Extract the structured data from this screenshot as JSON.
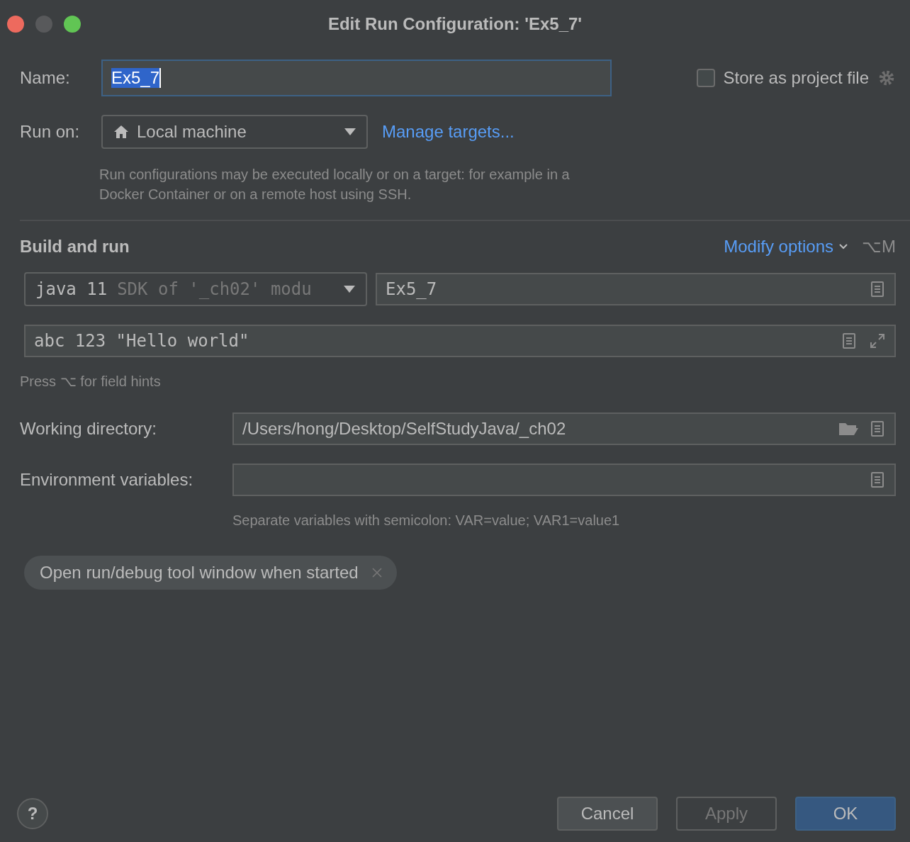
{
  "window": {
    "title": "Edit Run Configuration: 'Ex5_7'"
  },
  "name_field": {
    "label": "Name:",
    "value": "Ex5_7",
    "text_selected": true
  },
  "store_as_project_file": {
    "label": "Store as project file",
    "checked": false
  },
  "run_on": {
    "label": "Run on:",
    "value": "Local machine",
    "link": "Manage targets...",
    "hint": "Run configurations may be executed locally or on a target: for example in a Docker Container or on a remote host using SSH."
  },
  "build_and_run": {
    "title": "Build and run",
    "modify_options": "Modify options",
    "shortcut": "⌥M",
    "sdk": {
      "value": "java 11",
      "detail": "SDK of '_ch02' modu"
    },
    "main_class": "Ex5_7",
    "program_arguments": "abc 123 \"Hello world\"",
    "field_hints": "Press ⌥ for field hints"
  },
  "working_directory": {
    "label": "Working directory:",
    "value": "/Users/hong/Desktop/SelfStudyJava/_ch02"
  },
  "environment_variables": {
    "label": "Environment variables:",
    "hint": "Separate variables with semicolon: VAR=value; VAR1=value1"
  },
  "chips": [
    {
      "label": "Open run/debug tool window when started"
    }
  ],
  "help": "?",
  "buttons": [
    {
      "label": "Cancel",
      "kind": "default",
      "disabled": false
    },
    {
      "label": "Apply",
      "kind": "default",
      "disabled": true
    },
    {
      "label": "OK",
      "kind": "primary",
      "disabled": false
    }
  ]
}
